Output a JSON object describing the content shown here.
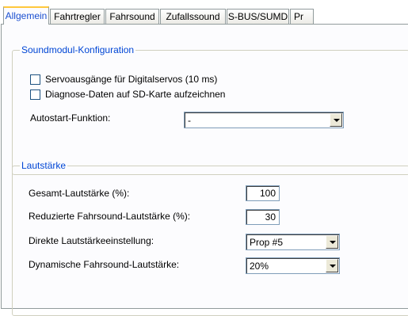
{
  "tabs": [
    {
      "label": "Allgemein",
      "active": true
    },
    {
      "label": "Fahrtregler",
      "active": false
    },
    {
      "label": "Fahrsound",
      "active": false
    },
    {
      "label": "Zufallssound",
      "active": false
    },
    {
      "label": "S-BUS/SUMD",
      "active": false
    },
    {
      "label": "Pr",
      "active": false
    }
  ],
  "soundmodul": {
    "title": "Soundmodul-Konfiguration",
    "servo_label": "Servoausgänge für Digitalservos (10 ms)",
    "servo_checked": false,
    "diagnose_label": "Diagnose-Daten auf SD-Karte aufzeichnen",
    "diagnose_checked": false,
    "autostart_label": "Autostart-Funktion:",
    "autostart_value": "-"
  },
  "lautstaerke": {
    "title": "Lautstärke",
    "gesamt_label": "Gesamt-Lautstärke (%):",
    "gesamt_value": "100",
    "reduziert_label": "Reduzierte Fahrsound-Lautstärke (%):",
    "reduziert_value": "30",
    "direkt_label": "Direkte Lautstärkeeinstellung:",
    "direkt_value": "Prop #5",
    "dynamisch_label": "Dynamische Fahrsound-Lautstärke:",
    "dynamisch_value": "20%"
  },
  "colors": {
    "group_title": "#0046d5",
    "active_tab_text": "#1a4fd0",
    "active_tab_highlight": "#ffc83c"
  },
  "icons": {
    "dropdown": "chevron-down-icon"
  }
}
